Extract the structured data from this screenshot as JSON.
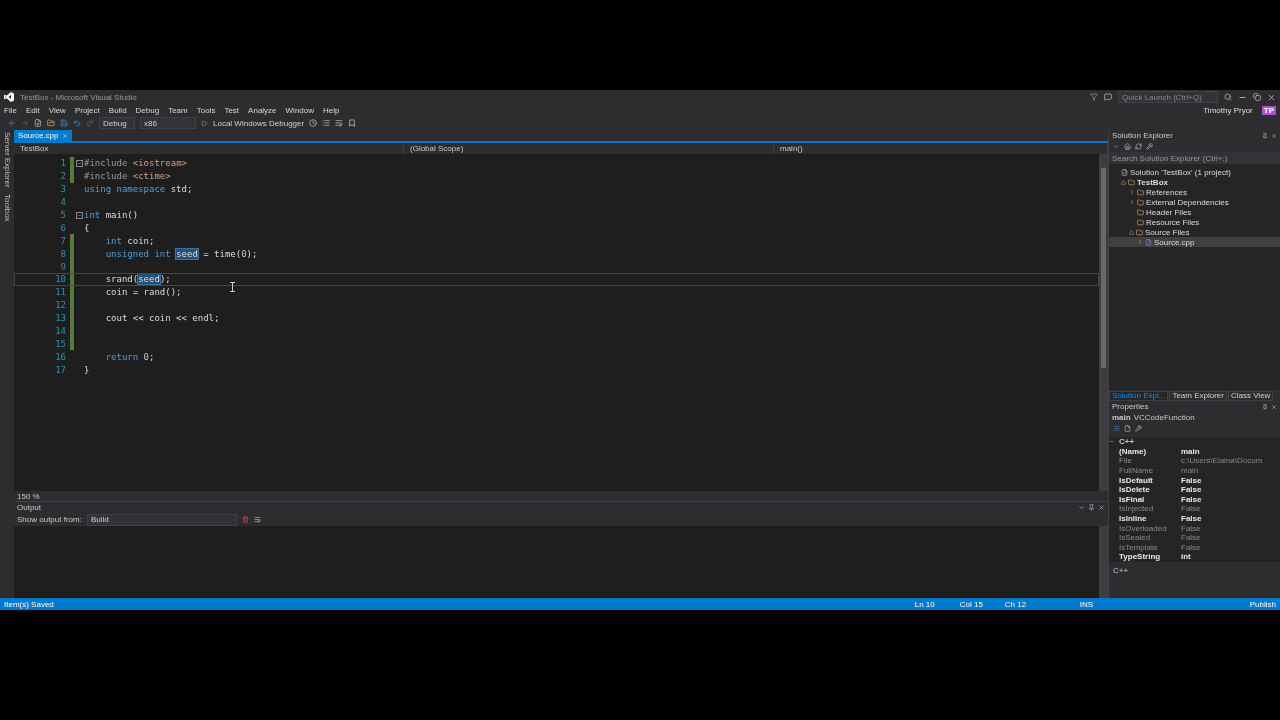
{
  "window": {
    "title": "TestBox - Microsoft Visual Studio",
    "quick_launch": {
      "placeholder": "Quick Launch (Ctrl+Q)"
    },
    "user": "Timothy Pryor",
    "avatar": "TP"
  },
  "menu": [
    "File",
    "Edit",
    "View",
    "Project",
    "Build",
    "Debug",
    "Team",
    "Tools",
    "Test",
    "Analyze",
    "Window",
    "Help"
  ],
  "toolbar": {
    "configuration": "Debug",
    "platform": "x86",
    "run": "Local Windows Debugger"
  },
  "side_tabs": [
    "Server Explorer",
    "Toolbox"
  ],
  "editor": {
    "tabs": [
      {
        "label": "Source.cpp",
        "selected": true
      }
    ],
    "nav": [
      "TestBox",
      "(Global Scope)",
      "main()"
    ],
    "lines": [
      {
        "number": "1",
        "fold": true,
        "changed": true,
        "current": false,
        "tokens": [
          {
            "kind": "preproc",
            "text": "#include"
          },
          {
            "kind": "string",
            "text": " <iostream>"
          }
        ]
      },
      {
        "number": "2",
        "fold": false,
        "changed": true,
        "current": false,
        "tokens": [
          {
            "kind": "preproc",
            "text": "#include"
          },
          {
            "kind": "string",
            "text": " <ctime>"
          }
        ]
      },
      {
        "number": "3",
        "fold": false,
        "changed": false,
        "current": false,
        "tokens": [
          {
            "kind": "keyword",
            "text": "using namespace"
          },
          {
            "kind": "plain",
            "text": " std;"
          }
        ]
      },
      {
        "number": "4",
        "fold": false,
        "changed": false,
        "current": false
      },
      {
        "number": "5",
        "fold": true,
        "changed": false,
        "current": false,
        "tokens": [
          {
            "kind": "keyword",
            "text": "int"
          },
          {
            "kind": "plain",
            "text": " main()"
          }
        ]
      },
      {
        "number": "6",
        "fold": false,
        "changed": false,
        "current": false,
        "tokens": [
          {
            "kind": "plain",
            "text": "{"
          }
        ]
      },
      {
        "number": "7",
        "fold": false,
        "changed": true,
        "current": false,
        "tokens": [
          {
            "kind": "keyword",
            "text": "    int"
          },
          {
            "kind": "plain",
            "text": " coin;"
          }
        ]
      },
      {
        "number": "8",
        "fold": false,
        "changed": true,
        "current": false,
        "tokens": [
          {
            "kind": "keyword",
            "text": "    unsigned int "
          },
          {
            "kind": "reference",
            "text": "seed"
          },
          {
            "kind": "plain",
            "text": " = time("
          },
          {
            "kind": "number",
            "text": "0"
          },
          {
            "kind": "plain",
            "text": ");"
          }
        ]
      },
      {
        "number": "9",
        "fold": false,
        "changed": true,
        "current": false
      },
      {
        "number": "10",
        "fold": false,
        "changed": true,
        "current": true,
        "tokens": [
          {
            "kind": "plain",
            "text": "    srand("
          },
          {
            "kind": "reference",
            "text": "seed"
          },
          {
            "kind": "plain",
            "text": ");"
          }
        ]
      },
      {
        "number": "11",
        "fold": false,
        "changed": true,
        "current": false,
        "tokens": [
          {
            "kind": "plain",
            "text": "    coin = rand();"
          }
        ]
      },
      {
        "number": "12",
        "fold": false,
        "changed": true,
        "current": false
      },
      {
        "number": "13",
        "fold": false,
        "changed": true,
        "current": false,
        "tokens": [
          {
            "kind": "plain",
            "text": "    cout << coin << endl;"
          }
        ]
      },
      {
        "number": "14",
        "fold": false,
        "changed": true,
        "current": false
      },
      {
        "number": "15",
        "fold": false,
        "changed": true,
        "current": false
      },
      {
        "number": "16",
        "fold": false,
        "changed": false,
        "current": false,
        "tokens": [
          {
            "kind": "keyword",
            "text": "    return"
          },
          {
            "kind": "number",
            "text": " 0"
          },
          {
            "kind": "plain",
            "text": ";"
          }
        ]
      },
      {
        "number": "17",
        "fold": false,
        "changed": false,
        "current": false,
        "tokens": [
          {
            "kind": "plain",
            "text": "}"
          }
        ]
      }
    ],
    "zoom": "150 %"
  },
  "output": {
    "title": "Output",
    "source_label": "Show output from:",
    "source": "Build"
  },
  "solution_explorer": {
    "title": "Solution Explorer",
    "search": {
      "placeholder": "Search Solution Explorer (Ctrl+;)"
    },
    "tree": [
      {
        "label": "Solution 'TestBox' (1 project)",
        "selected": false,
        "children": [
          {
            "label": "TestBox",
            "selected": false,
            "expanded": true,
            "children": [
              {
                "label": "References",
                "selected": false,
                "expanded": false
              },
              {
                "label": "External Dependencies",
                "selected": false,
                "expanded": false
              },
              {
                "label": "Header Files",
                "selected": false
              },
              {
                "label": "Resource Files",
                "selected": false
              },
              {
                "label": "Source Files",
                "selected": false,
                "expanded": true,
                "children": [
                  {
                    "label": "Source.cpp",
                    "selected": true,
                    "expanded": false
                  }
                ]
              }
            ]
          }
        ]
      }
    ],
    "tabs": [
      {
        "label": "Solution Expl...",
        "selected": true
      },
      {
        "label": "Team Explorer",
        "selected": false
      },
      {
        "label": "Class View",
        "selected": false
      }
    ]
  },
  "properties": {
    "title": "Properties",
    "object": "main",
    "object_type": "VCCodeFunction",
    "category": "C++",
    "rows": [
      {
        "name": "(Name)",
        "value": "main",
        "disabled": false
      },
      {
        "name": "File",
        "value": "c:\\Users\\Elaina\\Docum",
        "disabled": true
      },
      {
        "name": "FullName",
        "value": "main",
        "disabled": true
      },
      {
        "name": "IsDefault",
        "value": "False",
        "disabled": false
      },
      {
        "name": "IsDelete",
        "value": "False",
        "disabled": false
      },
      {
        "name": "IsFinal",
        "value": "False",
        "disabled": false
      },
      {
        "name": "IsInjected",
        "value": "False",
        "disabled": true
      },
      {
        "name": "IsInline",
        "value": "False",
        "disabled": false
      },
      {
        "name": "IsOverloaded",
        "value": "False",
        "disabled": true
      },
      {
        "name": "IsSealed",
        "value": "False",
        "disabled": true
      },
      {
        "name": "IsTemplate",
        "value": "False",
        "disabled": true
      },
      {
        "name": "TypeString",
        "value": "int",
        "disabled": false
      }
    ],
    "description": "C++"
  },
  "status_bar": {
    "message": "Item(s) Saved",
    "line": "Ln 10",
    "column": "Col 15",
    "char": "Ch 12",
    "mode": "INS",
    "publish": "Publish"
  }
}
